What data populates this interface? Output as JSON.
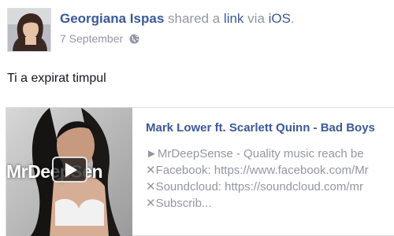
{
  "post": {
    "author": "Georgiana Ispas",
    "action_text": "shared a",
    "link_text": "link",
    "via_text": "via",
    "via_app": "iOS",
    "date": "7 September",
    "privacy_icon": "globe-icon",
    "message": "Ti a expirat timpul"
  },
  "attachment": {
    "watermark": "MrDeepSen",
    "title": "Mark Lower ft. Scarlett Quinn - Bad Boys",
    "description_lines": [
      "►MrDeepSense - Quality music reach be",
      "✕Facebook: https://www.facebook.com/Mr",
      "✕Soundcloud: https://soundcloud.com/mr",
      "✕Subscrib..."
    ],
    "play_icon": "play-icon"
  },
  "colors": {
    "link_blue": "#3b5998",
    "muted_gray": "#9197a3",
    "text": "#141823",
    "border": "#dcdee3"
  }
}
